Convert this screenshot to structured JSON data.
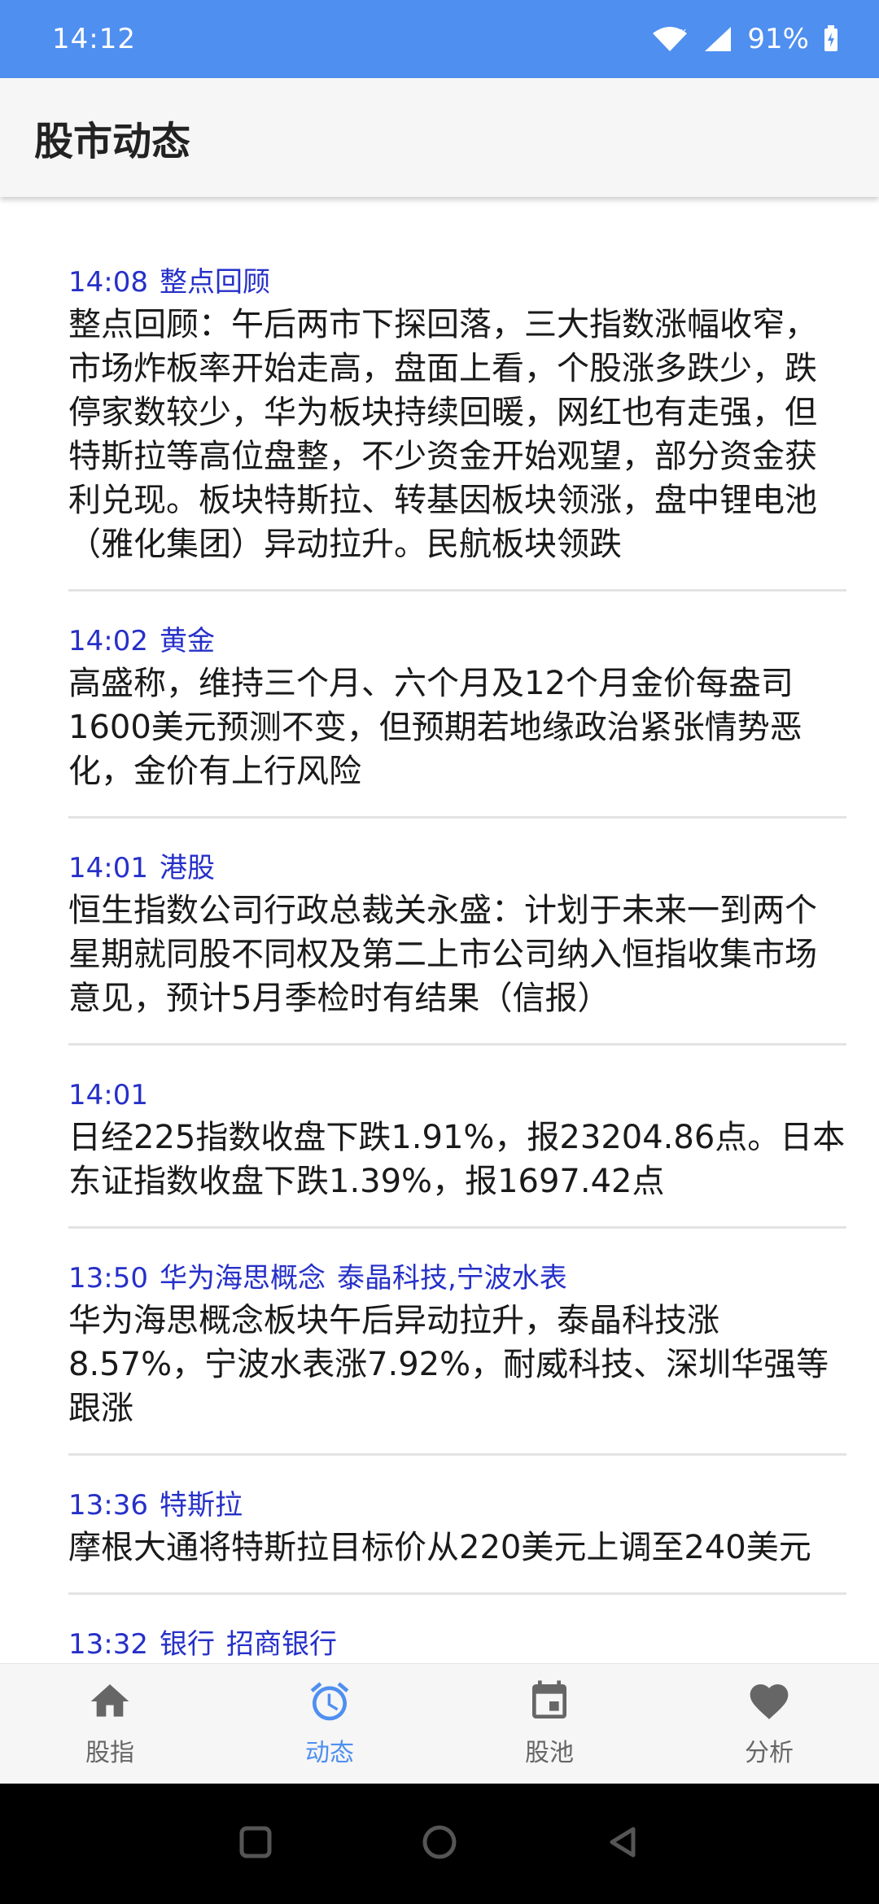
{
  "status_bar": {
    "time": "14:12",
    "battery": "91%"
  },
  "app_bar": {
    "title": "股市动态"
  },
  "news": [
    {
      "time": "14:08",
      "tags": [
        "整点回顾"
      ],
      "text": "整点回顾：午后两市下探回落，三大指数涨幅收窄，市场炸板率开始走高，盘面上看，个股涨多跌少，跌停家数较少，华为板块持续回暖，网红也有走强，但特斯拉等高位盘整，不少资金开始观望，部分资金获利兑现。板块特斯拉、转基因板块领涨，盘中锂电池（雅化集团）异动拉升。民航板块领跌"
    },
    {
      "time": "14:02",
      "tags": [
        "黄金"
      ],
      "text": "高盛称，维持三个月、六个月及12个月金价每盎司1600美元预测不变，但预期若地缘政治紧张情势恶化，金价有上行风险"
    },
    {
      "time": "14:01",
      "tags": [
        "港股"
      ],
      "text": "恒生指数公司行政总裁关永盛：计划于未来一到两个星期就同股不同权及第二上市公司纳入恒指收集市场意见，预计5月季检时有结果（信报）"
    },
    {
      "time": "14:01",
      "tags": [],
      "text": "日经225指数收盘下跌1.91%，报23204.86点。日本东证指数收盘下跌1.39%，报1697.42点"
    },
    {
      "time": "13:50",
      "tags": [
        "华为海思概念",
        "泰晶科技,宁波水表"
      ],
      "text": "华为海思概念板块午后异动拉升，泰晶科技涨8.57%，宁波水表涨7.92%，耐威科技、深圳华强等跟涨"
    },
    {
      "time": "13:36",
      "tags": [
        "特斯拉"
      ],
      "text": "摩根大通将特斯拉目标价从220美元上调至240美元"
    },
    {
      "time": "13:32",
      "tags": [
        "银行",
        "招商银行"
      ],
      "text": ""
    }
  ],
  "bottom_nav": [
    {
      "label": "股指",
      "icon": "home-icon",
      "active": false
    },
    {
      "label": "动态",
      "icon": "alarm-clock-icon",
      "active": true
    },
    {
      "label": "股池",
      "icon": "calendar-icon",
      "active": false
    },
    {
      "label": "分析",
      "icon": "heart-icon",
      "active": false
    }
  ],
  "colors": {
    "accent": "#4f8ff0",
    "headline": "#2630c8"
  }
}
